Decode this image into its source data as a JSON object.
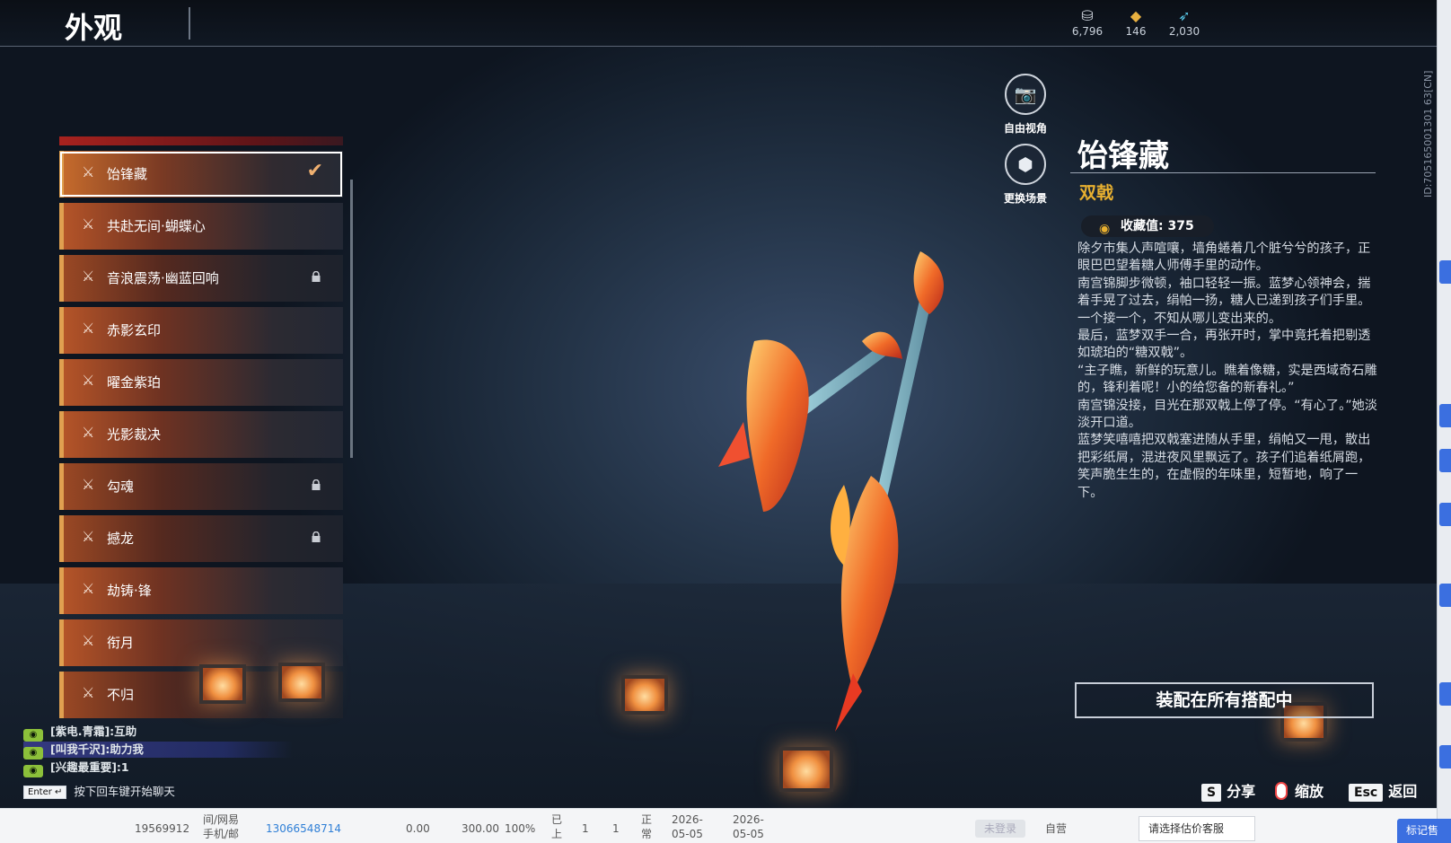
{
  "header": {
    "title": "外观",
    "currencies": [
      {
        "icon": "silver-coin-icon",
        "value": "6,796"
      },
      {
        "icon": "gold-ingot-icon",
        "value": "146"
      },
      {
        "icon": "feather-icon",
        "value": "2,030"
      }
    ]
  },
  "id_label": "ID:705165001301 63[CN]",
  "skins": [
    {
      "name": "饴锋藏",
      "selected": true,
      "locked": false
    },
    {
      "name": "共赴无间·蝴蝶心",
      "selected": false,
      "locked": false
    },
    {
      "name": "音浪震荡·幽蓝回响",
      "selected": false,
      "locked": true
    },
    {
      "name": "赤影玄印",
      "selected": false,
      "locked": false
    },
    {
      "name": "曜金紫珀",
      "selected": false,
      "locked": false
    },
    {
      "name": "光影裁决",
      "selected": false,
      "locked": false
    },
    {
      "name": "勾魂",
      "selected": false,
      "locked": true
    },
    {
      "name": "撼龙",
      "selected": false,
      "locked": true
    },
    {
      "name": "劫铸·锋",
      "selected": false,
      "locked": false
    },
    {
      "name": "衔月",
      "selected": false,
      "locked": false
    },
    {
      "name": "不归",
      "selected": false,
      "locked": true
    }
  ],
  "camera": {
    "free_view": "自由视角",
    "change_scene": "更换场景"
  },
  "detail": {
    "name": "饴锋藏",
    "type": "双戟",
    "collect_label": "收藏值:",
    "collect_value": "375",
    "description": [
      "除夕市集人声喧嚷，墙角蜷着几个脏兮兮的孩子，正眼巴巴望着糖人师傅手里的动作。",
      "南宫锦脚步微顿，袖口轻轻一振。蓝梦心领神会，揣着手晃了过去，绢帕一扬，糖人已递到孩子们手里。一个接一个，不知从哪儿变出来的。",
      "最后，蓝梦双手一合，再张开时，掌中竟托着把剔透如琥珀的“糖双戟”。",
      "“主子瞧，新鲜的玩意儿。瞧着像糖，实是西域奇石雕的，锋利着呢！小的给您备的新春礼。”",
      "南宫锦没接，目光在那双戟上停了停。“有心了。”她淡淡开口道。",
      "蓝梦笑嘻嘻把双戟塞进随从手里，绢帕又一甩，散出把彩纸屑，混进夜风里飘远了。孩子们追着纸屑跑，笑声脆生生的，在虚假的年味里，短暂地，响了一下。"
    ],
    "equip_button": "装配在所有搭配中"
  },
  "chat": {
    "lines": [
      {
        "text": "[紫电.青霜]:互助",
        "highlight": false
      },
      {
        "text": "[叫我千沢]:助力我",
        "highlight": true
      },
      {
        "text": "[兴趣最重要]:1",
        "highlight": false
      }
    ],
    "enter_key": "Enter",
    "hint": "按下回车键开始聊天"
  },
  "hotkeys": {
    "share_key": "S",
    "share_label": "分享",
    "zoom_label": "缩放",
    "back_key": "Esc",
    "back_label": "返回"
  },
  "background_row": {
    "id": "19569912",
    "source": "间/网易",
    "source2": "手机/邮",
    "phone": "13066548714",
    "amount1": "0.00",
    "amount2": "300.00",
    "percent": "100%",
    "status1": "已",
    "status1b": "上",
    "count1": "1",
    "count2": "1",
    "status2": "正",
    "status2b": "常",
    "date1": "2026-",
    "date1b": "05-05",
    "date2": "2026-",
    "date2b": "05-05",
    "gray_btn": "未登录",
    "owner": "自营",
    "select_placeholder": "请选择估价客服",
    "corner_btn": "标记售"
  },
  "colors": {
    "accent": "#e8b030",
    "list_border": "#e0a050",
    "chat_tag": "#8cc03a",
    "web_blue": "#3b6fe0"
  }
}
